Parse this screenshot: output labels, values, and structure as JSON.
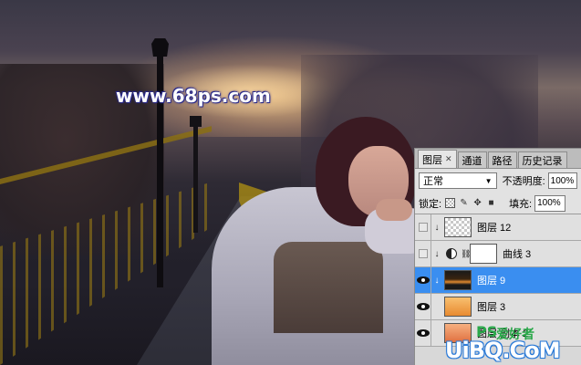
{
  "canvas": {
    "watermark_text": "www.68ps.com"
  },
  "layers_panel": {
    "tabs": [
      {
        "label": "图层",
        "active": true,
        "closable": true
      },
      {
        "label": "通道",
        "active": false
      },
      {
        "label": "路径",
        "active": false
      },
      {
        "label": "历史记录",
        "active": false
      }
    ],
    "blend_mode": "正常",
    "opacity_label": "不透明度:",
    "opacity_value": "100%",
    "lock_label": "锁定:",
    "fill_label": "填充:",
    "fill_value": "100%",
    "layers": [
      {
        "name": "图层 12",
        "visible": false,
        "clipped": true,
        "thumb": "checker",
        "selected": false
      },
      {
        "name": "曲线 3",
        "visible": false,
        "clipped": true,
        "thumb": "white",
        "adjustment": true,
        "selected": false
      },
      {
        "name": "图层 9",
        "visible": true,
        "clipped": true,
        "thumb": "night",
        "selected": true
      },
      {
        "name": "图层 3",
        "visible": true,
        "clipped": false,
        "thumb": "orange",
        "selected": false
      },
      {
        "name": "图层 副本 2",
        "visible": true,
        "clipped": false,
        "thumb": "orange2",
        "selected": false
      }
    ]
  },
  "site_logo": {
    "ps": "PS",
    "cn": "爱好者",
    "main": "UiBQ.CoM"
  }
}
